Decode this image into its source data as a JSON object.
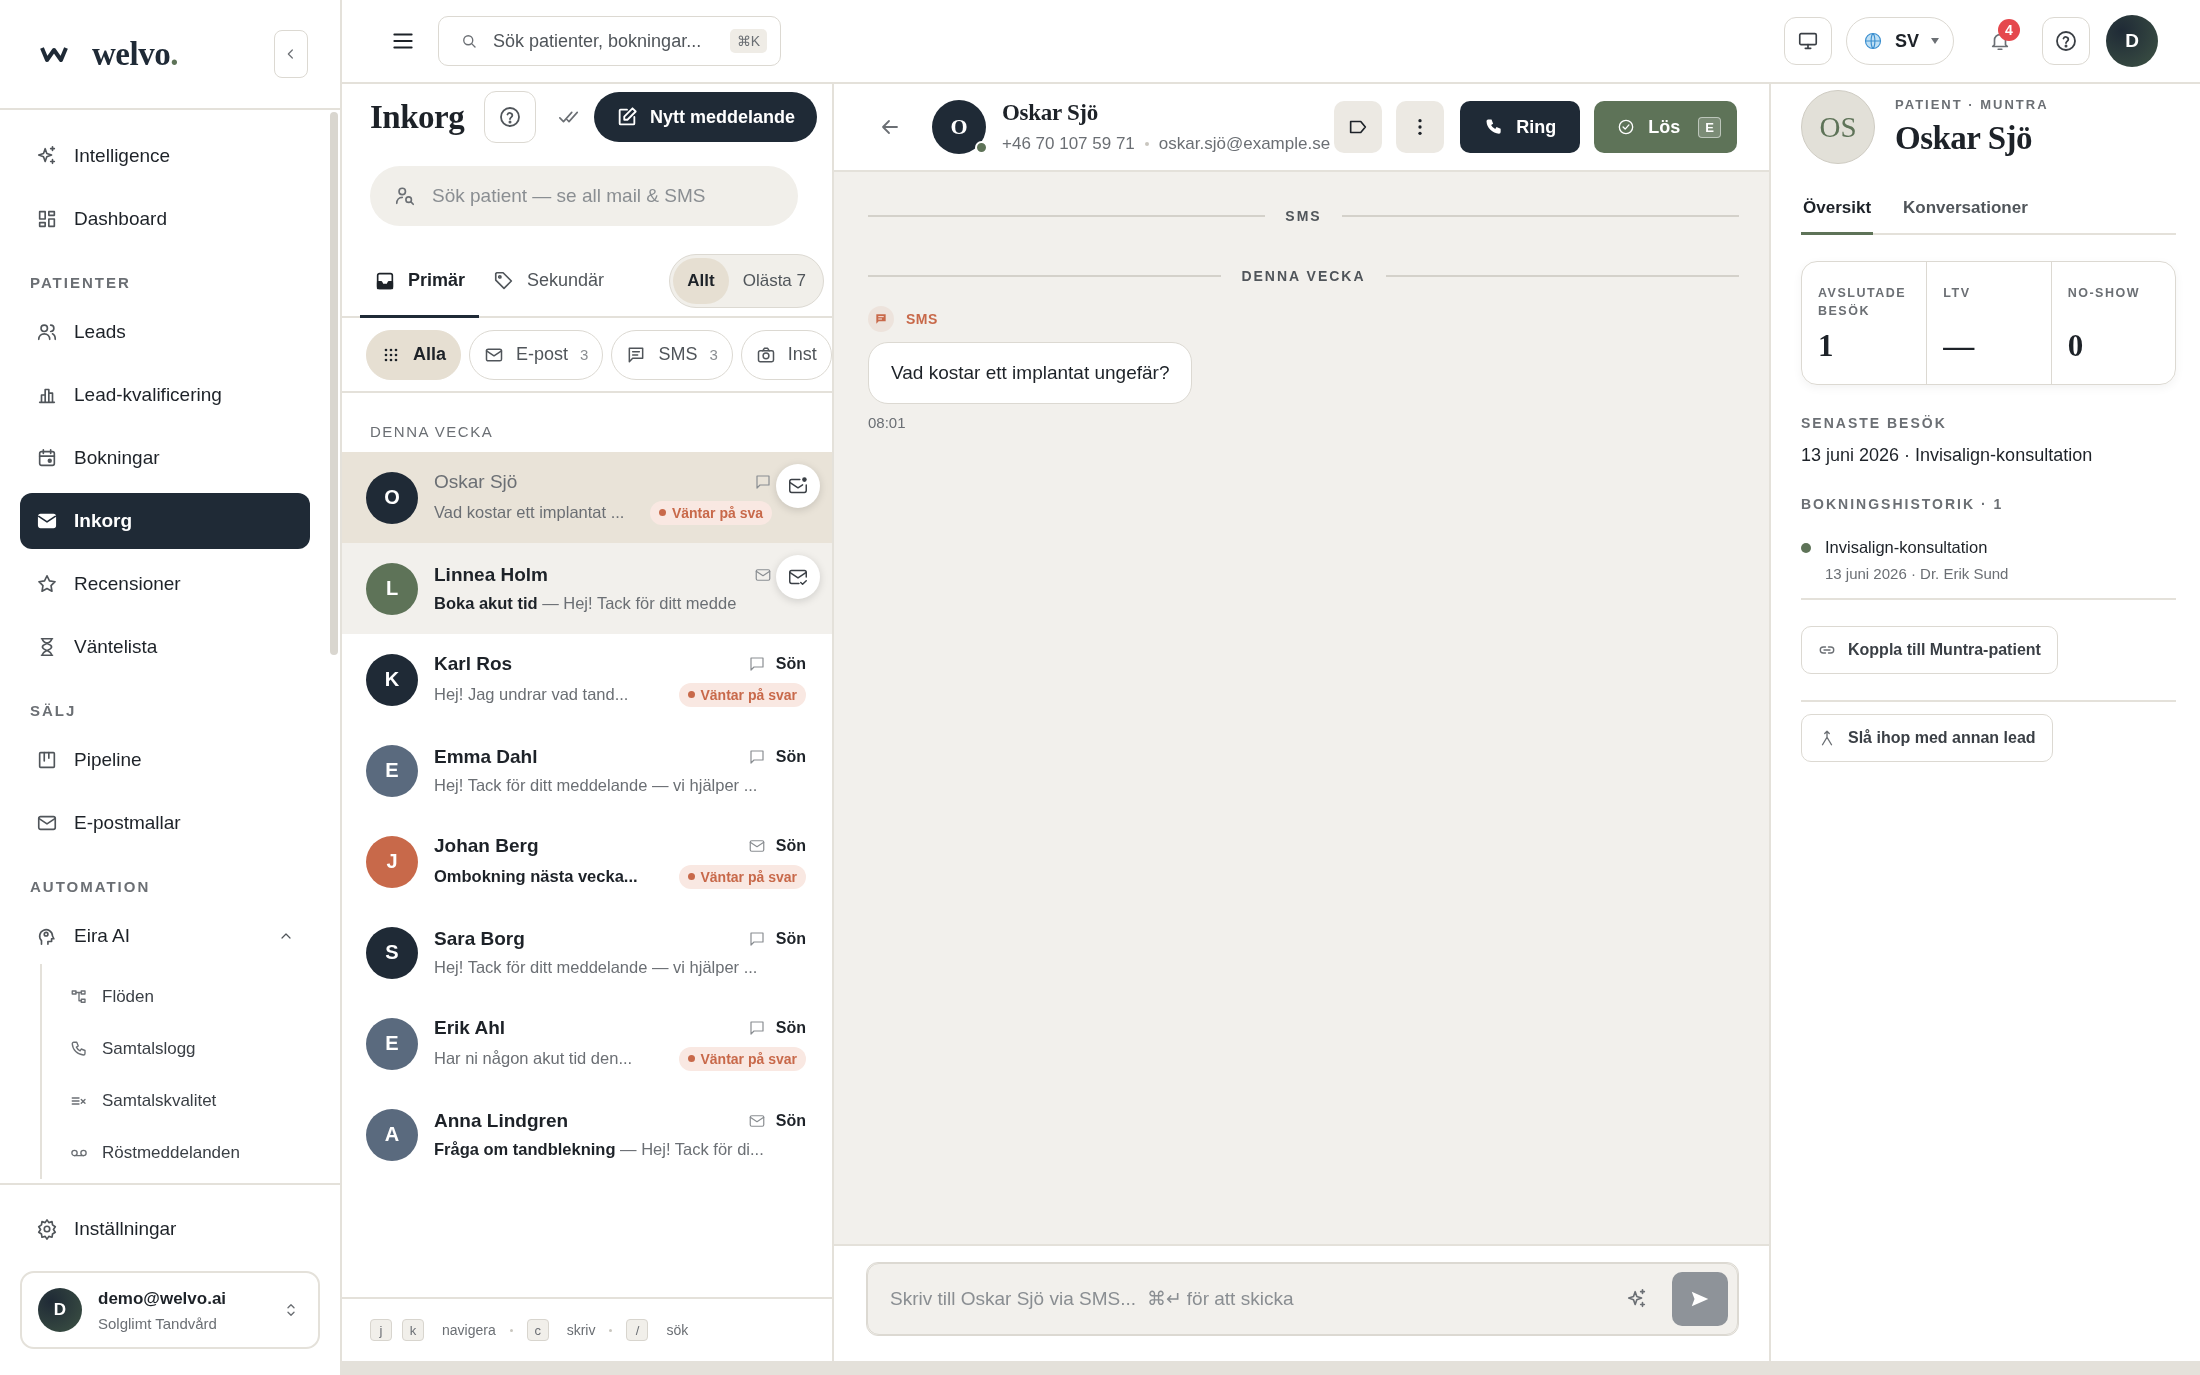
{
  "topbar": {
    "search": {
      "placeholder": "Sök patienter, bokningar...",
      "shortcut": "⌘K"
    },
    "language": "SV",
    "notifications": "4",
    "user_initial": "D"
  },
  "sidebar": {
    "logo": "welvo.",
    "sections": [
      {
        "items": [
          {
            "label": "Intelligence",
            "selected": false
          },
          {
            "label": "Dashboard",
            "selected": false
          }
        ]
      },
      {
        "title": "PATIENTER",
        "items": [
          {
            "label": "Leads",
            "selected": false
          },
          {
            "label": "Lead-kvalificering",
            "selected": false
          },
          {
            "label": "Bokningar",
            "selected": false
          },
          {
            "label": "Inkorg",
            "selected": true
          },
          {
            "label": "Recensioner",
            "selected": false
          },
          {
            "label": "Väntelista",
            "selected": false
          }
        ]
      },
      {
        "title": "SÄLJ",
        "items": [
          {
            "label": "Pipeline",
            "selected": false
          },
          {
            "label": "E-postmallar",
            "selected": false
          }
        ]
      },
      {
        "title": "AUTOMATION",
        "items": [
          {
            "label": "Eira AI",
            "selected": false,
            "expanded": true,
            "children": [
              {
                "label": "Flöden",
                "selected": false
              },
              {
                "label": "Samtalslogg",
                "selected": false
              },
              {
                "label": "Samtalskvalitet",
                "selected": false
              },
              {
                "label": "Röstmeddelanden",
                "selected": false
              }
            ]
          }
        ]
      }
    ],
    "settings": "Inställningar",
    "account": {
      "initial": "D",
      "email": "demo@welvo.ai",
      "org": "Solglimt Tandvård"
    }
  },
  "inbox": {
    "title": "Inkorg",
    "new_button": "Nytt meddelande",
    "search": {
      "placeholder": "Sök patient — se all mail & SMS"
    },
    "tabs": [
      {
        "label": "Primär",
        "selected": true
      },
      {
        "label": "Sekundär",
        "selected": false
      }
    ],
    "scope": [
      {
        "label": "Allt",
        "selected": true
      },
      {
        "label": "Olästa 7",
        "selected": false
      }
    ],
    "filters": [
      {
        "label": "Alla",
        "selected": true
      },
      {
        "label": "E-post",
        "count": "3",
        "selected": false
      },
      {
        "label": "SMS",
        "count": "3",
        "selected": false
      },
      {
        "label": "Inst",
        "selected": false
      }
    ],
    "group": "DENNA VECKA",
    "rows": [
      {
        "name": "Oskar Sjö",
        "initial": "O",
        "color": "#1f2a36",
        "kind": "sms",
        "unread": false,
        "selected": true,
        "highlighted": false,
        "snippet": "Vad kostar ett implantat ...",
        "badge": "Väntar på sva",
        "quick_action": {
          "kind": "mark_unread"
        }
      },
      {
        "name": "Linnea Holm",
        "initial": "L",
        "color": "#5e7358",
        "kind": "email",
        "unread": true,
        "selected": false,
        "highlighted": true,
        "subject": "Boka akut tid",
        "snippet": "— Hej! Tack för ditt medde",
        "quick_action": {
          "kind": "mark_read"
        }
      },
      {
        "name": "Karl Ros",
        "initial": "K",
        "color": "#1f2a36",
        "kind": "sms",
        "unread": true,
        "selected": false,
        "highlighted": false,
        "time": "Sön",
        "snippet": "Hej! Jag undrar vad tand...",
        "badge": "Väntar på svar"
      },
      {
        "name": "Emma Dahl",
        "initial": "E",
        "color": "#5a6a7e",
        "kind": "sms",
        "unread": true,
        "selected": false,
        "highlighted": false,
        "time": "Sön",
        "snippet": "Hej! Tack för ditt meddelande — vi hjälper ..."
      },
      {
        "name": "Johan Berg",
        "initial": "J",
        "color": "#c8694a",
        "kind": "email",
        "unread": true,
        "selected": false,
        "highlighted": false,
        "time": "Sön",
        "subject": "Ombokning nästa vecka...",
        "badge": "Väntar på svar"
      },
      {
        "name": "Sara Borg",
        "initial": "S",
        "color": "#1f2a36",
        "kind": "sms",
        "unread": true,
        "selected": false,
        "highlighted": false,
        "time": "Sön",
        "snippet": "Hej! Tack för ditt meddelande — vi hjälper ..."
      },
      {
        "name": "Erik Ahl",
        "initial": "E",
        "color": "#5a6a7e",
        "kind": "sms",
        "unread": true,
        "selected": false,
        "highlighted": false,
        "time": "Sön",
        "snippet": "Har ni någon akut tid den...",
        "badge": "Väntar på svar"
      },
      {
        "name": "Anna Lindgren",
        "initial": "A",
        "color": "#5a6a7e",
        "kind": "email",
        "unread": true,
        "selected": false,
        "highlighted": false,
        "time": "Sön",
        "subject": "Fråga om tandblekning",
        "snippet": "— Hej! Tack för di..."
      }
    ],
    "shortcuts": [
      {
        "keys": [
          "j",
          "k"
        ],
        "label": "navigera"
      },
      {
        "keys": [
          "c"
        ],
        "label": "skriv"
      },
      {
        "keys": [
          "/"
        ],
        "label": "sök"
      }
    ]
  },
  "conversation": {
    "name": "Oskar Sjö",
    "initial": "O",
    "online": true,
    "phone": "+46 70 107 59 71",
    "email": "oskar.sjö@example.se",
    "call_button": "Ring",
    "resolve_button": "Lös",
    "resolve_shortcut": "E",
    "channel_divider": "SMS",
    "day_divider": "DENNA VECKA",
    "messages": [
      {
        "channel": "SMS",
        "text": "Vad kostar ett implantat ungefär?",
        "time": "08:01"
      }
    ],
    "composer": {
      "placeholder": "Skriv till Oskar Sjö via SMS...  ⌘↵ för att skicka",
      "send_disabled": true
    }
  },
  "patient": {
    "initials": "OS",
    "eyebrow": "PATIENT · MUNTRA",
    "name": "Oskar Sjö",
    "tabs": [
      {
        "label": "Översikt",
        "selected": true
      },
      {
        "label": "Konversationer",
        "selected": false
      }
    ],
    "stats": [
      {
        "label": "AVSLUTADE BESÖK",
        "value": "1"
      },
      {
        "label": "LTV",
        "value": "—"
      },
      {
        "label": "NO-SHOW",
        "value": "0"
      }
    ],
    "last_visit": {
      "label": "SENASTE BESÖK",
      "text": "13 juni 2026 · Invisalign-konsultation"
    },
    "history": {
      "label": "BOKNINGSHISTORIK · 1",
      "items": [
        {
          "title": "Invisalign-konsultation",
          "detail": "13 juni 2026 · Dr. Erik Sund"
        }
      ]
    },
    "actions": [
      "Koppla till Muntra-patient",
      "Slå ihop med annan lead"
    ]
  }
}
